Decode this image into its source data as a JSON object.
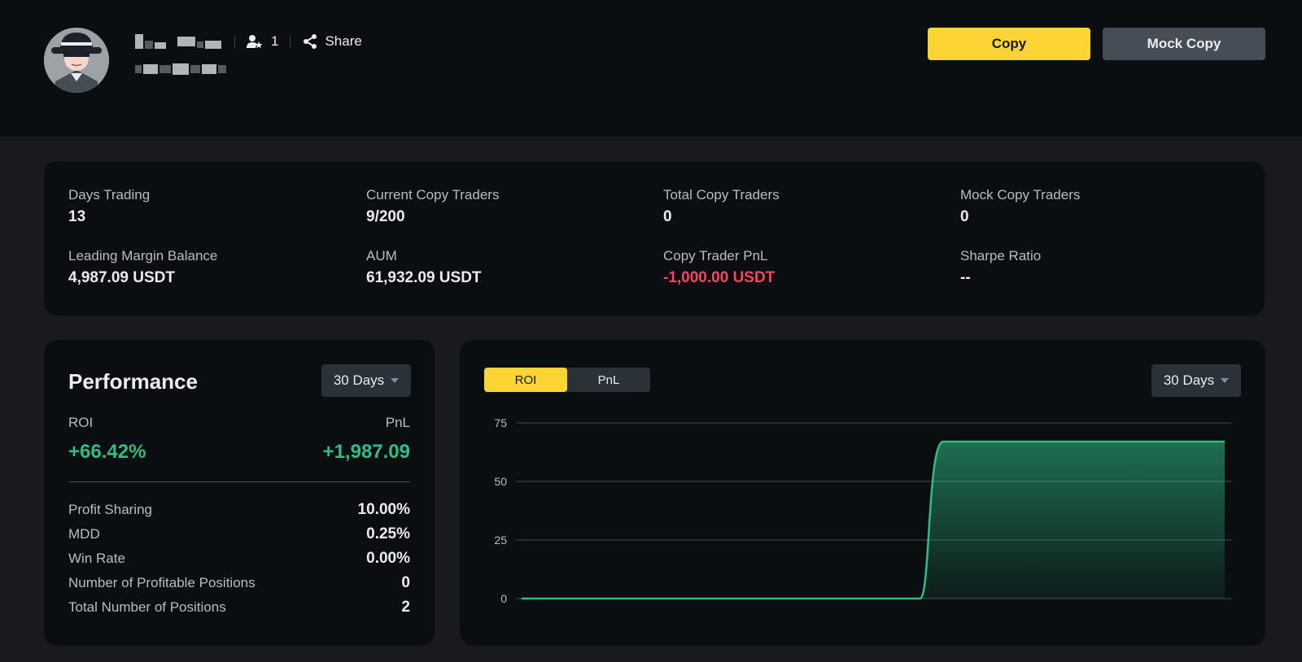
{
  "header": {
    "followers_count": "1",
    "share_label": "Share",
    "copy_button": "Copy",
    "mock_copy_button": "Mock Copy",
    "icons": [
      "avatar",
      "user-star-icon",
      "share-icon"
    ]
  },
  "stats": [
    {
      "label": "Days Trading",
      "value": "13"
    },
    {
      "label": "Current Copy Traders",
      "value": "9/200"
    },
    {
      "label": "Total Copy Traders",
      "value": "0"
    },
    {
      "label": "Mock Copy Traders",
      "value": "0"
    },
    {
      "label": "Leading Margin Balance",
      "value": "4,987.09 USDT"
    },
    {
      "label": "AUM",
      "value": "61,932.09 USDT"
    },
    {
      "label": "Copy Trader PnL",
      "value": "-1,000.00 USDT"
    },
    {
      "label": "Sharpe Ratio",
      "value": "--"
    }
  ],
  "performance": {
    "title": "Performance",
    "period": "30 Days",
    "roi_label": "ROI",
    "roi_value": "+66.42%",
    "pnl_label": "PnL",
    "pnl_value": "+1,987.09",
    "metrics": [
      {
        "label": "Profit Sharing",
        "value": "10.00%"
      },
      {
        "label": "MDD",
        "value": "0.25%"
      },
      {
        "label": "Win Rate",
        "value": "0.00%"
      },
      {
        "label": "Number of Profitable Positions",
        "value": "0"
      },
      {
        "label": "Total Number of Positions",
        "value": "2"
      }
    ]
  },
  "chart_panel": {
    "tabs": [
      "ROI",
      "PnL"
    ],
    "active_tab": "ROI",
    "period": "30 Days"
  },
  "colors": {
    "accent": "#fcd535",
    "positive": "#2ebd85",
    "negative": "#f6465d",
    "panel": "#0b0e11",
    "background": "#181a20"
  },
  "chart_data": {
    "type": "area",
    "title": "",
    "xlabel": "",
    "ylabel": "",
    "ylim": [
      0,
      75
    ],
    "yticks": [
      0,
      25,
      50,
      75
    ],
    "grid": true,
    "series": [
      {
        "values": [
          0,
          0,
          0,
          0,
          0,
          0,
          0,
          0,
          0,
          0,
          0,
          0,
          0,
          0,
          0,
          0,
          0,
          0,
          67,
          67,
          67,
          67,
          67,
          67,
          67,
          67,
          67,
          67,
          67,
          67,
          67
        ]
      }
    ]
  }
}
